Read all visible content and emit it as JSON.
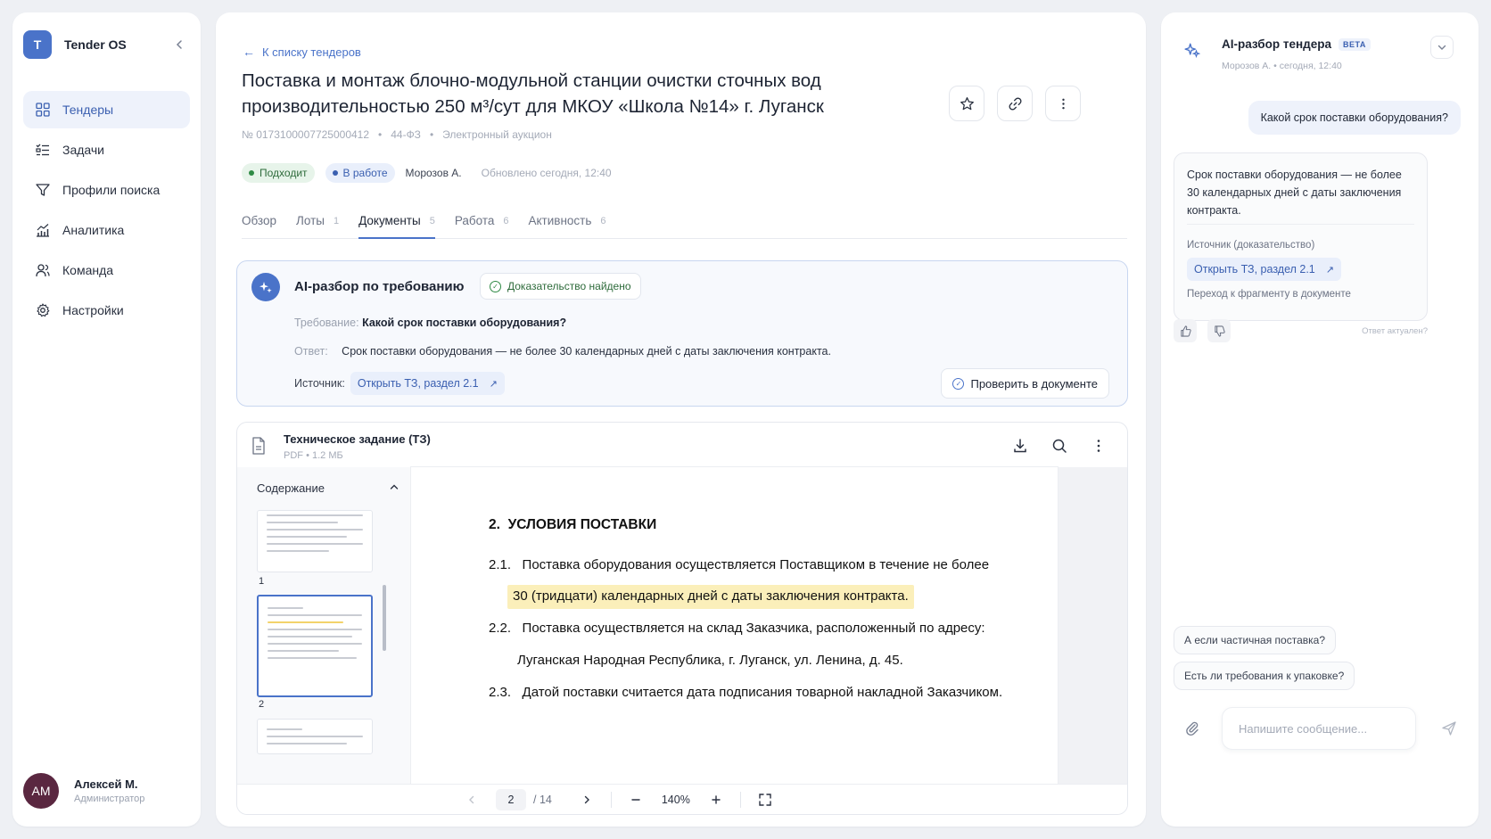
{
  "sidebar": {
    "brand_letter": "T",
    "brand_name": "Tender OS",
    "items": [
      {
        "label": "Тендеры",
        "icon": "grid-icon",
        "active": true
      },
      {
        "label": "Задачи",
        "icon": "checklist-icon"
      },
      {
        "label": "Профили поиска",
        "icon": "filter-icon"
      },
      {
        "label": "Аналитика",
        "icon": "analytics-icon"
      },
      {
        "label": "Команда",
        "icon": "team-icon"
      },
      {
        "label": "Настройки",
        "icon": "gear-icon"
      }
    ],
    "user": {
      "initials": "AM",
      "name": "Алексей М.",
      "role": "Администратор"
    }
  },
  "main": {
    "back_label": "К списку тендеров",
    "title": "Поставка и монтаж блочно-модульной станции очистки сточных вод производительностью 250 м³/сут для МКОУ «Школа №14» г. Луганск",
    "meta": {
      "number": "№ 0173100007725000412",
      "law": "44-ФЗ",
      "procedure": "Электронный аукцион"
    },
    "status": {
      "badge_fit": "Подходит",
      "badge_work": "В работе",
      "assignee": "Морозов А.",
      "updated": "Обновлено сегодня, 12:40"
    },
    "tabs": [
      {
        "label": "Обзор",
        "count": ""
      },
      {
        "label": "Лоты",
        "count": "1"
      },
      {
        "label": "Документы",
        "count": "5",
        "active": true
      },
      {
        "label": "Работа",
        "count": "6"
      },
      {
        "label": "Активность",
        "count": "6"
      }
    ],
    "ai_card": {
      "title": "AI-разбор по требованию",
      "evidence": "Доказательство найдено",
      "req_label": "Требование:",
      "req_value": "Какой срок поставки оборудования?",
      "ans_label": "Ответ:",
      "ans_value": "Срок поставки оборудования — не более 30 календарных дней с даты заключения контракта.",
      "src_label": "Источник:",
      "src_link": "Открыть ТЗ, раздел 2.1",
      "verify_btn": "Проверить в документе"
    },
    "doc": {
      "name": "Техническое задание (ТЗ)",
      "format": "PDF",
      "size": "1.2 МБ",
      "toc_title": "Содержание",
      "thumbs": [
        "1",
        "2"
      ],
      "heading_num": "2.",
      "heading": "УСЛОВИЯ ПОСТАВКИ",
      "p1_num": "2.1.",
      "p1": "Поставка оборудования осуществляется Поставщиком в течение не более",
      "p1_hl": "30 (тридцати) календарных дней с даты заключения контракта.",
      "p2_num": "2.2.",
      "p2": "Поставка осуществляется на склад Заказчика, расположенный по адресу:",
      "p2_cont": "Луганская Народная Республика, г. Луганск, ул. Ленина, д. 45.",
      "p3_num": "2.3.",
      "p3": "Датой поставки считается дата подписания товарной накладной Заказчиком.",
      "page_current": "2",
      "page_total": "/ 14",
      "zoom": "140%"
    }
  },
  "chat": {
    "title": "AI-разбор тендера",
    "beta": "BETA",
    "sub": "Морозов А. • сегодня, 12:40",
    "user_msg": "Какой срок поставки оборудования?",
    "ai_msg": "Срок поставки оборудования — не более 30 календарных дней с даты заключения контракта.",
    "src_label": "Источник (доказательство)",
    "src_link": "Открыть ТЗ, раздел 2.1",
    "jump": "Переход к фрагменту в документе",
    "feedback_q": "Ответ актуален?",
    "suggestions": [
      "А если частичная поставка?",
      "Есть ли требования к упаковке?"
    ],
    "input_placeholder": "Напишите сообщение..."
  },
  "colors": {
    "accent": "#4a73c9",
    "success": "#2f8a45",
    "highlight": "#fbefba",
    "avatar": "#5a2740"
  }
}
